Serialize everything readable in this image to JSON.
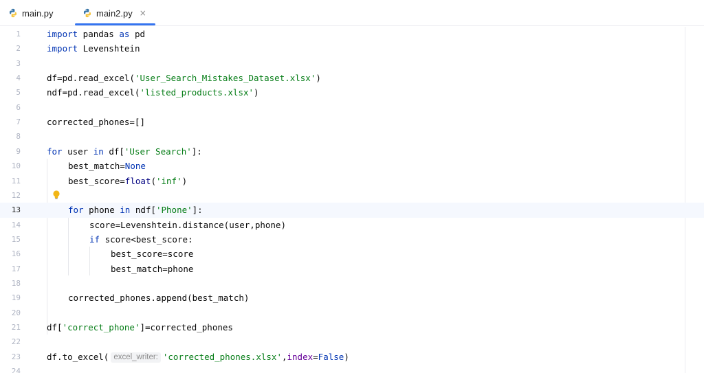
{
  "tabs": [
    {
      "label": "main.py",
      "icon": "python-icon",
      "active": false
    },
    {
      "label": "main2.py",
      "icon": "python-icon",
      "active": true,
      "close_glyph": "×"
    }
  ],
  "colors": {
    "keyword": "#0033b3",
    "string": "#067d17",
    "named_param": "#660099",
    "tab_underline": "#3574f0",
    "current_line": "#f5f8fe"
  },
  "editor": {
    "current_line": 13,
    "lines": [
      {
        "n": "1"
      },
      {
        "n": "2"
      },
      {
        "n": "3"
      },
      {
        "n": "4"
      },
      {
        "n": "5"
      },
      {
        "n": "6"
      },
      {
        "n": "7"
      },
      {
        "n": "8"
      },
      {
        "n": "9"
      },
      {
        "n": "10"
      },
      {
        "n": "11"
      },
      {
        "n": "12"
      },
      {
        "n": "13"
      },
      {
        "n": "14"
      },
      {
        "n": "15"
      },
      {
        "n": "16"
      },
      {
        "n": "17"
      },
      {
        "n": "18"
      },
      {
        "n": "19"
      },
      {
        "n": "20"
      },
      {
        "n": "21"
      },
      {
        "n": "22"
      },
      {
        "n": "23"
      },
      {
        "n": "24"
      }
    ],
    "code": {
      "l1": {
        "kw1": "import",
        "t1": " pandas ",
        "kw2": "as",
        "t2": " pd"
      },
      "l2": {
        "kw1": "import",
        "t1": " Levenshtein"
      },
      "l4": {
        "t1": "df=pd.read_excel(",
        "s1": "'User_Search_Mistakes_Dataset.xlsx'",
        "t2": ")"
      },
      "l5": {
        "t1": "ndf=pd.read_excel(",
        "s1": "'listed_products.xlsx'",
        "t2": ")"
      },
      "l7": {
        "t1": "corrected_phones=[]"
      },
      "l9": {
        "kw1": "for",
        "t1": " user ",
        "kw2": "in",
        "t2": " df[",
        "s1": "'User Search'",
        "t3": "]:"
      },
      "l10": {
        "t1": "best_match=",
        "kw1": "None"
      },
      "l11": {
        "t1": "best_score=",
        "kw1": "float",
        "t2": "(",
        "s1": "'inf'",
        "t3": ")"
      },
      "l13": {
        "kw1": "for",
        "t1": " phone ",
        "kw2": "in",
        "t2": " ndf[",
        "s1": "'Phone'",
        "t3": "]:"
      },
      "l14": {
        "t1": "score=Levenshtein.distance(user,phone)"
      },
      "l15": {
        "kw1": "if",
        "t1": " score<best_score:"
      },
      "l16": {
        "t1": "best_score=score"
      },
      "l17": {
        "t1": "best_match=phone"
      },
      "l19": {
        "t1": "corrected_phones.append(best_match)"
      },
      "l21": {
        "t1": "df[",
        "s1": "'correct_phone'",
        "t2": "]=corrected_phones"
      },
      "l23": {
        "t1": "df.to_excel(",
        "hint": "excel_writer:",
        "s1": "'corrected_phones.xlsx'",
        "t2": ",",
        "p1": "index",
        "t3": "=",
        "kw1": "False",
        "t4": ")"
      }
    }
  }
}
